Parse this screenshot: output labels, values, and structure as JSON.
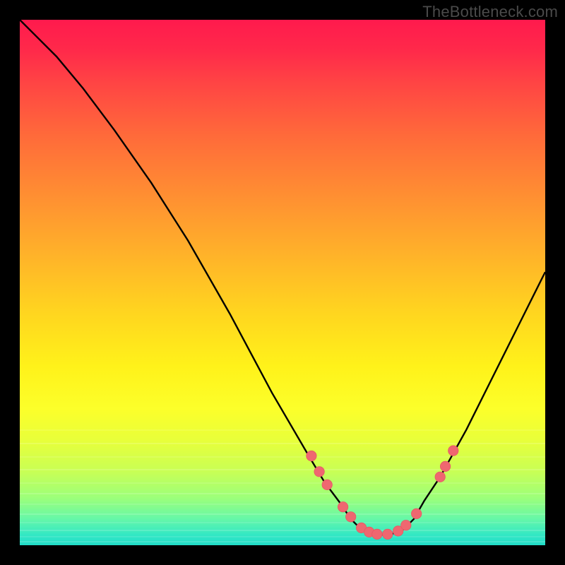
{
  "watermark": "TheBottleneck.com",
  "colors": {
    "background": "#000000",
    "curve": "#000000",
    "dot_fill": "#ef6770",
    "dot_stroke": "#e55a64"
  },
  "chart_data": {
    "type": "line",
    "title": "",
    "xlabel": "",
    "ylabel": "",
    "xlim": [
      0,
      100
    ],
    "ylim": [
      0,
      100
    ],
    "series": [
      {
        "name": "bottleneck-curve",
        "x": [
          0,
          3,
          7,
          12,
          18,
          25,
          32,
          40,
          48,
          55,
          58,
          61,
          63,
          65,
          67,
          69,
          71,
          73,
          75,
          77,
          80,
          85,
          90,
          95,
          100
        ],
        "y": [
          100,
          97,
          93,
          87,
          79,
          69,
          58,
          44,
          29,
          17,
          12,
          8,
          5,
          3,
          2.2,
          2,
          2.2,
          3,
          5,
          8.5,
          13,
          22,
          32,
          42,
          52
        ]
      }
    ],
    "markers": {
      "name": "highlight-dots",
      "x": [
        55.5,
        57,
        58.5,
        61.5,
        63,
        65,
        66.5,
        68,
        70,
        72,
        73.5,
        75.5,
        80,
        81,
        82.5
      ],
      "y": [
        17,
        14,
        11.5,
        7.3,
        5.4,
        3.3,
        2.5,
        2.1,
        2.1,
        2.7,
        3.8,
        6,
        13,
        15,
        18
      ]
    },
    "bands_y": [
      78,
      80.5,
      83,
      85.5,
      88,
      90,
      92,
      94,
      95.5,
      97,
      98.2,
      99.2
    ]
  }
}
